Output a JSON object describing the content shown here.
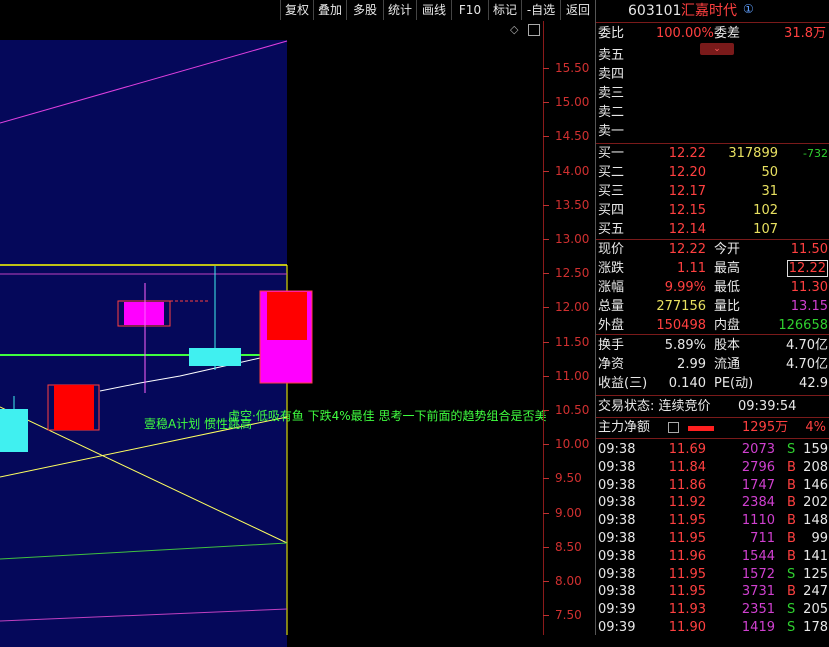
{
  "toolbar": {
    "buttons": [
      "复权",
      "叠加",
      "多股",
      "统计",
      "画线",
      "F10",
      "标记",
      "-自选",
      "返回"
    ]
  },
  "header": {
    "code": "603101",
    "name": "汇嘉时代",
    "badge": "①"
  },
  "chart": {
    "price_ticks": [
      "15.50",
      "15.00",
      "14.50",
      "14.00",
      "13.50",
      "13.00",
      "12.50",
      "12.00",
      "11.50",
      "11.00",
      "10.50",
      "10.00",
      "9.50",
      "9.00",
      "8.50",
      "8.00",
      "7.50"
    ],
    "annotation_left": "壹稳A计划 惯性跳高",
    "annotation_right": "虚空·低吸有鱼 下跌4%最佳 思考一下前面的趋势组合是否美",
    "colors": {
      "bg": "#05085a",
      "up": "#ff0000",
      "down": "#00ffff",
      "magenta": "#ff00ff"
    }
  },
  "weibi": {
    "label": "委比",
    "value": "100.00%",
    "diff_label": "委差",
    "diff_value": "31.8万"
  },
  "sell": [
    {
      "label": "卖五"
    },
    {
      "label": "卖四"
    },
    {
      "label": "卖三"
    },
    {
      "label": "卖二"
    },
    {
      "label": "卖一"
    }
  ],
  "buy": [
    {
      "label": "买一",
      "price": "12.22",
      "vol": "317899",
      "chg": "-732"
    },
    {
      "label": "买二",
      "price": "12.20",
      "vol": "50",
      "chg": ""
    },
    {
      "label": "买三",
      "price": "12.17",
      "vol": "31",
      "chg": ""
    },
    {
      "label": "买四",
      "price": "12.15",
      "vol": "102",
      "chg": ""
    },
    {
      "label": "买五",
      "price": "12.14",
      "vol": "107",
      "chg": ""
    }
  ],
  "quote": [
    {
      "l1": "现价",
      "v1": "12.22",
      "l2": "今开",
      "v2": "11.50"
    },
    {
      "l1": "涨跌",
      "v1": "1.11",
      "l2": "最高",
      "v2": "12.22"
    },
    {
      "l1": "涨幅",
      "v1": "9.99%",
      "l2": "最低",
      "v2": "11.30"
    },
    {
      "l1": "总量",
      "v1": "277156",
      "l2": "量比",
      "v2": "13.15"
    },
    {
      "l1": "外盘",
      "v1": "150498",
      "l2": "内盘",
      "v2": "126658"
    }
  ],
  "fin": [
    {
      "l1": "换手",
      "v1": "5.89%",
      "l2": "股本",
      "v2": "4.70亿"
    },
    {
      "l1": "净资",
      "v1": "2.99",
      "l2": "流通",
      "v2": "4.70亿"
    },
    {
      "l1": "收益(三)",
      "v1": "0.140",
      "l2": "PE(动)",
      "v2": "42.9"
    }
  ],
  "trade_status": {
    "label": "交易状态: 连续竞价",
    "time": "09:39:54"
  },
  "main_flow": {
    "label": "主力净额",
    "value": "1295万",
    "pct": "4%"
  },
  "ticks": [
    {
      "t": "09:38",
      "p": "11.69",
      "v": "2073",
      "s": "S",
      "n": "159"
    },
    {
      "t": "09:38",
      "p": "11.84",
      "v": "2796",
      "s": "B",
      "n": "208"
    },
    {
      "t": "09:38",
      "p": "11.86",
      "v": "1747",
      "s": "B",
      "n": "146"
    },
    {
      "t": "09:38",
      "p": "11.92",
      "v": "2384",
      "s": "B",
      "n": "202"
    },
    {
      "t": "09:38",
      "p": "11.95",
      "v": "1110",
      "s": "B",
      "n": "148"
    },
    {
      "t": "09:38",
      "p": "11.95",
      "v": "711",
      "s": "B",
      "n": "99"
    },
    {
      "t": "09:38",
      "p": "11.96",
      "v": "1544",
      "s": "B",
      "n": "141"
    },
    {
      "t": "09:38",
      "p": "11.95",
      "v": "1572",
      "s": "S",
      "n": "125"
    },
    {
      "t": "09:38",
      "p": "11.95",
      "v": "3731",
      "s": "B",
      "n": "247"
    },
    {
      "t": "09:39",
      "p": "11.93",
      "v": "2351",
      "s": "S",
      "n": "205"
    },
    {
      "t": "09:39",
      "p": "11.90",
      "v": "1419",
      "s": "S",
      "n": "178"
    }
  ]
}
